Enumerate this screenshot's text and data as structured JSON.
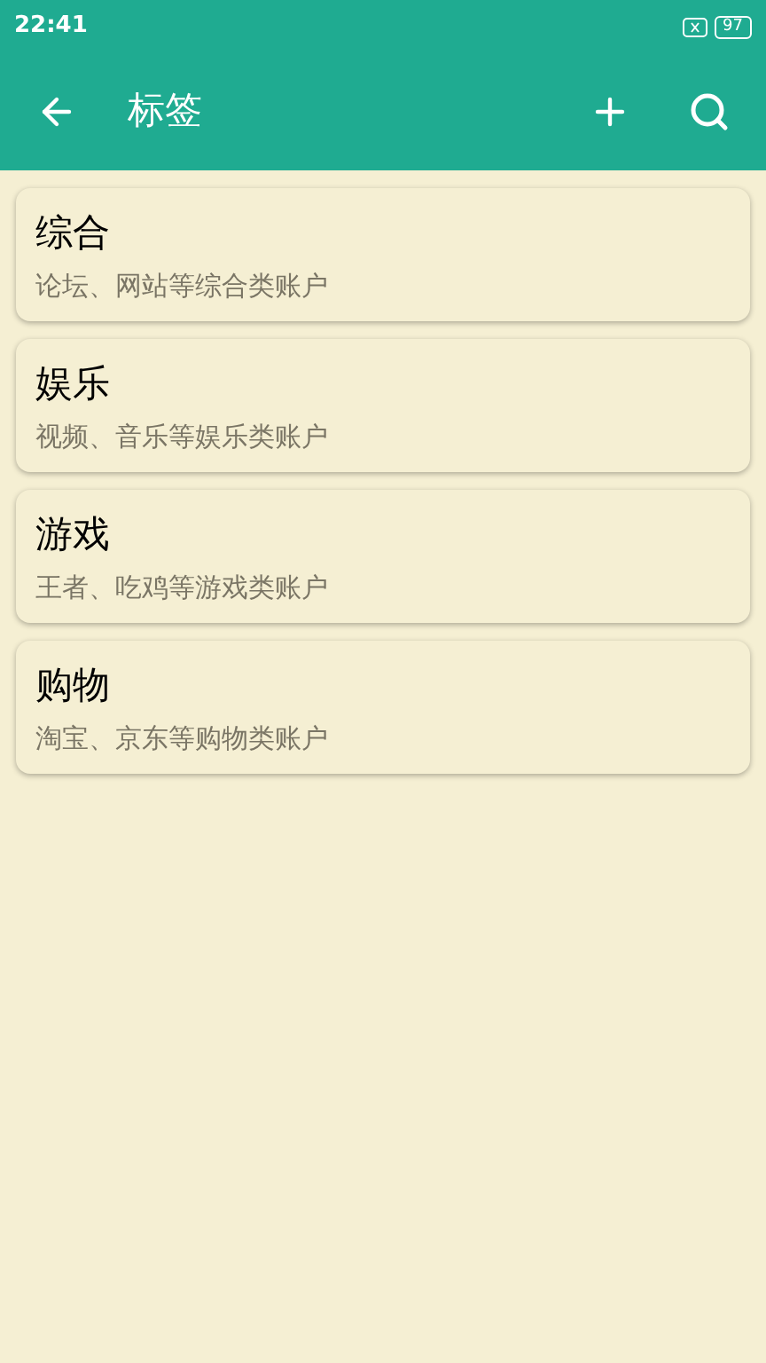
{
  "status_bar": {
    "time": "22:41",
    "battery": "97"
  },
  "app_bar": {
    "title": "标签"
  },
  "tags": [
    {
      "name": "综合",
      "description": "论坛、网站等综合类账户"
    },
    {
      "name": "娱乐",
      "description": "视频、音乐等娱乐类账户"
    },
    {
      "name": "游戏",
      "description": "王者、吃鸡等游戏类账户"
    },
    {
      "name": "购物",
      "description": "淘宝、京东等购物类账户"
    }
  ]
}
